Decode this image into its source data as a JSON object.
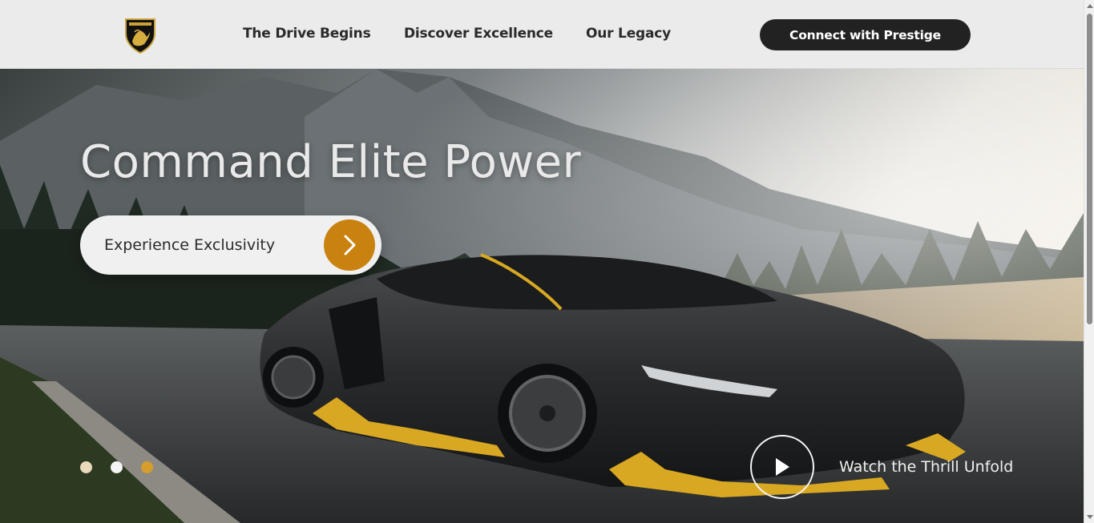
{
  "header": {
    "logo_icon": "bull-shield-logo-icon",
    "nav": [
      {
        "label": "The Drive Begins"
      },
      {
        "label": "Discover Excellence"
      },
      {
        "label": "Our Legacy"
      }
    ],
    "cta_label": "Connect with Prestige"
  },
  "hero": {
    "title": "Command Elite Power",
    "explore_label": "Experience Exclusivity",
    "explore_icon": "chevron-right-icon",
    "slides": [
      {
        "color": "#ead9bd",
        "active": false
      },
      {
        "color": "#f4f4f4",
        "active": false
      },
      {
        "color": "#d79d2c",
        "active": true
      }
    ],
    "play_icon": "play-icon",
    "watch_label": "Watch the Thrill Unfold"
  },
  "colors": {
    "accent": "#c9820f",
    "dark": "#222222",
    "header_bg": "#ebebeb"
  }
}
